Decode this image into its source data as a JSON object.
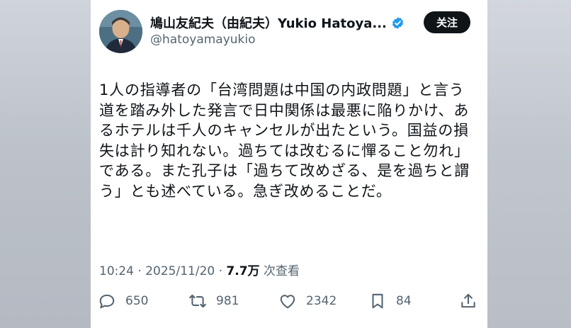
{
  "tweet": {
    "author": {
      "display_name": "鳩山友紀夫（由紀夫）Yukio Hatoya...",
      "handle": "@hatoyamayukio",
      "verified": true,
      "avatar_icon": "user-avatar"
    },
    "follow_label": "关注",
    "text": "1人の指導者の「台湾問題は中国の内政問題」と言う道を踏み外した発言で日中関係は最悪に陥りかけ、あるホテルは千人のキャンセルが出たという。国益の損失は計り知れない。過ちては改むるに憚ること勿れ」である。また孔子は「過ちて改めざる、是を過ちと謂う」とも述べている。急ぎ改めることだ。",
    "time": "10:24",
    "separator": "·",
    "date": "2025/11/20",
    "views_separator": "·",
    "views_count": "7.7万",
    "views_label": "次查看",
    "stats": {
      "replies": "650",
      "retweets": "981",
      "likes": "2342",
      "bookmarks": "84"
    }
  },
  "colors": {
    "verified_badge": "#1d9bf0",
    "follow_button_bg": "#0f1419",
    "text_primary": "#0f1419",
    "text_secondary": "#536471"
  }
}
